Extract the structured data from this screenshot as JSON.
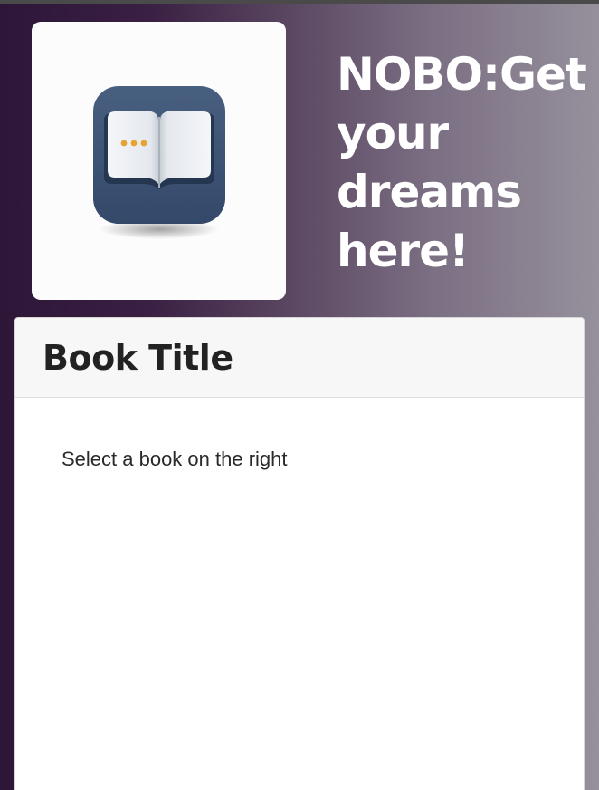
{
  "header": {
    "logo_icon": "open-book-app-icon",
    "title": "NOBO:Get your dreams here!"
  },
  "card": {
    "title": "Book Title",
    "placeholder_text": "Select a book on the right"
  },
  "colors": {
    "gradient_start": "#2d1638",
    "gradient_end": "#96909c",
    "icon_tile": "#3e5575",
    "page_dots": "#e6a332"
  }
}
